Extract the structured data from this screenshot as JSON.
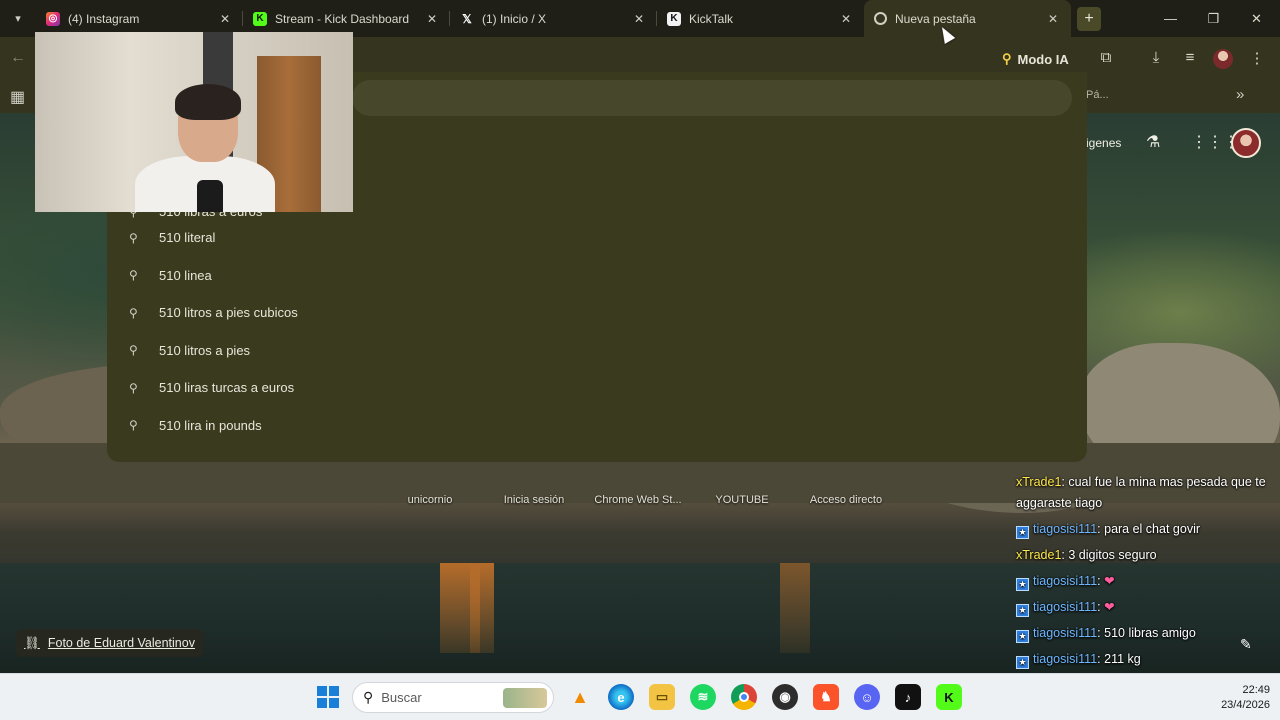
{
  "tabs": [
    {
      "title": "(4) Instagram",
      "favicon": "instagram-icon",
      "active": false
    },
    {
      "title": "Stream - Kick Dashboard",
      "favicon": "kick-icon",
      "active": false
    },
    {
      "title": "(1) Inicio / X",
      "favicon": "x-icon",
      "active": false
    },
    {
      "title": "KickTalk",
      "favicon": "kicktalk-icon",
      "active": false
    },
    {
      "title": "Nueva pestaña",
      "favicon": "chrome-icon",
      "active": true
    }
  ],
  "toolbar": {
    "modo_ia_label": "Modo IA"
  },
  "bookmarks": {
    "truncated_label": "Pá..."
  },
  "suggestions": [
    "510 libras a euros",
    "510 literal",
    "510 linea",
    "510 litros a pies cubicos",
    "510 litros a pies",
    "510 liras turcas a euros",
    "510 lira in pounds"
  ],
  "ntp": {
    "images_label": "igenes"
  },
  "shortcuts": [
    {
      "label": "unicornio"
    },
    {
      "label": "Inicia sesión"
    },
    {
      "label": "Chrome Web St..."
    },
    {
      "label": "YOUTUBE"
    },
    {
      "label": "Acceso directo"
    }
  ],
  "chat": [
    {
      "user": "xTrade1",
      "message": ": cual fue la mina mas pesada que te aggaraste tiago",
      "badge": false
    },
    {
      "user": "tiagosisi111",
      "message": ": para el chat govir",
      "badge": true
    },
    {
      "user": "xTrade1",
      "message": ": 3 digitos seguro",
      "badge": false
    },
    {
      "user": "tiagosisi111",
      "message": ": ",
      "emote": "❤",
      "badge": true
    },
    {
      "user": "tiagosisi111",
      "message": ": ",
      "emote": "❤",
      "badge": true
    },
    {
      "user": "tiagosisi111",
      "message": ": 510 libras amigo",
      "badge": true
    },
    {
      "user": "tiagosisi111",
      "message": ": 211 kg",
      "badge": true
    }
  ],
  "photo_credit": "Foto de Eduard Valentinov",
  "taskbar": {
    "search_placeholder": "Buscar",
    "time": "22:49",
    "date": "23/4/2026"
  },
  "colors": {
    "panel_bg": "#3a3a1e",
    "chat_user_yellow": "#ffe94a",
    "chat_user_blue": "#6fb6ff"
  }
}
